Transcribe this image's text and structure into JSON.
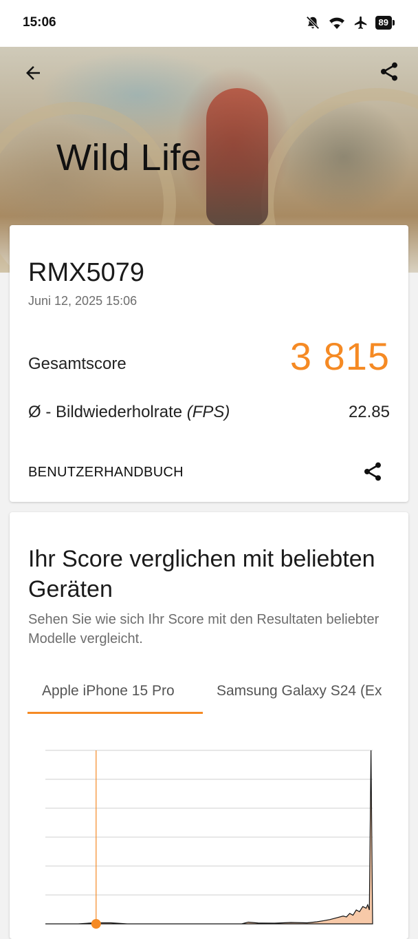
{
  "status_bar": {
    "time": "15:06",
    "battery": "89",
    "icons": [
      "bell-off-icon",
      "wifi-icon",
      "airplane-icon",
      "battery-icon"
    ]
  },
  "header": {
    "title": "Wild Life",
    "back_icon": "arrow-left-icon",
    "share_icon": "share-icon"
  },
  "result": {
    "device": "RMX5079",
    "date": "Juni 12, 2025 15:06",
    "score_label": "Gesamtscore",
    "score_value": "3 815",
    "fps_label_prefix": "Ø - Bildwiederholrate ",
    "fps_label_unit": "(FPS)",
    "fps_value": "22.85",
    "manual_label": "BENUTZERHANDBUCH"
  },
  "comparison": {
    "title": "Ihr Score verglichen mit beliebten Geräten",
    "subtitle": "Sehen Sie wie sich Ihr Score mit den Resultaten beliebter Modelle vergleicht.",
    "tabs": [
      {
        "label": "Apple iPhone 15 Pro",
        "active": true
      },
      {
        "label": "Samsung Galaxy S24 (Ex"
      }
    ]
  },
  "colors": {
    "accent": "#f58a24",
    "histogram_fill": "#f7c9a8"
  },
  "chart_data": {
    "type": "area",
    "title": "",
    "xlabel": "",
    "ylabel": "",
    "x": [
      0,
      0.05,
      0.1,
      0.15,
      0.2,
      0.25,
      0.3,
      0.35,
      0.4,
      0.45,
      0.5,
      0.55,
      0.6,
      0.62,
      0.65,
      0.7,
      0.75,
      0.8,
      0.83,
      0.85,
      0.87,
      0.89,
      0.91,
      0.92,
      0.93,
      0.94,
      0.95,
      0.96,
      0.97,
      0.98,
      0.985,
      0.99,
      0.995,
      1.0
    ],
    "y": [
      0,
      0,
      0,
      0.006,
      0.006,
      0,
      0,
      0,
      0,
      0,
      0,
      0,
      0,
      0.01,
      0.005,
      0.004,
      0.008,
      0.006,
      0.012,
      0.018,
      0.025,
      0.035,
      0.045,
      0.04,
      0.06,
      0.05,
      0.08,
      0.07,
      0.1,
      0.09,
      0.11,
      0.08,
      1.0,
      0
    ],
    "ylim": [
      0,
      1
    ],
    "grid": true,
    "marker_x": 0.155
  }
}
